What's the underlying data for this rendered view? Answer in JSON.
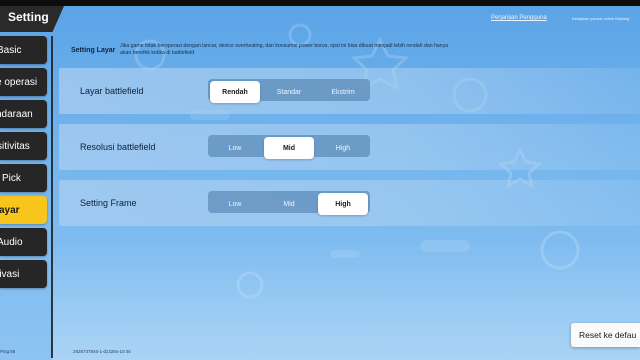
{
  "header": {
    "title": "Setting",
    "top_link": "Perjanjian Pengguna",
    "top_sub": "Kebijakan privasi online Bidilung"
  },
  "sidebar": {
    "items": [
      {
        "label": "Basic",
        "active": false
      },
      {
        "label": "e operasi",
        "active": false
      },
      {
        "label": "ndaraan",
        "active": false
      },
      {
        "label": "sitivitas",
        "active": false
      },
      {
        "label": "Pick",
        "active": false
      },
      {
        "label": "ayar",
        "active": true
      },
      {
        "label": "Audio",
        "active": false
      },
      {
        "label": "rivasi",
        "active": false
      }
    ]
  },
  "section": {
    "label": "Setting Layar",
    "description": "Jika game tidak beroperasi dengan lancar, device overheating, dan konsumsi power boros, opsi ini bisa dibuat menjadi lebih rendah dan hanya akan berefek ketika di battlefield"
  },
  "settings": [
    {
      "label": "Layar battlefield",
      "options": [
        "Rendah",
        "Standar",
        "Ekstrim"
      ],
      "selected": "Rendah"
    },
    {
      "label": "Resolusi battlefield",
      "options": [
        "Low",
        "Mid",
        "High"
      ],
      "selected": "Mid"
    },
    {
      "label": "Setting Frame",
      "options": [
        "Low",
        "Mid",
        "High"
      ],
      "selected": "High"
    }
  ],
  "reset_label": "Reset ke defau",
  "footer": {
    "left": "Ping:56",
    "center": "2826737846-1-dz328s-10:46"
  },
  "colors": {
    "accent": "#f7c51b",
    "sidebar_bg": "#262626",
    "background": "#6cb0ec"
  }
}
